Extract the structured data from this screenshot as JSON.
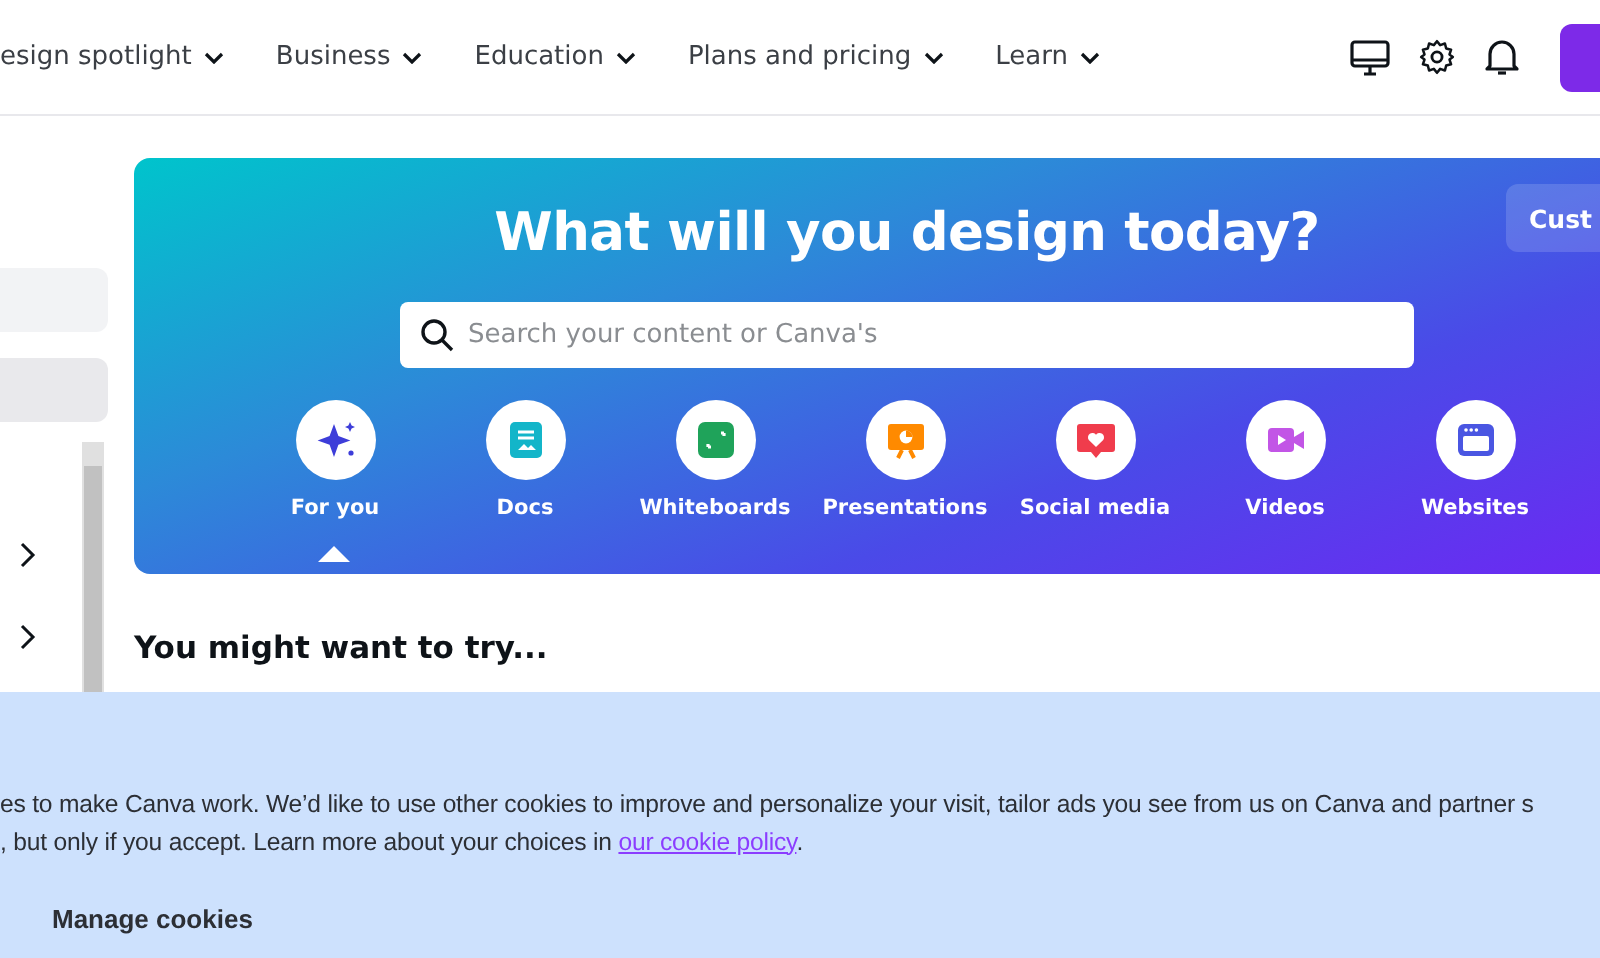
{
  "nav": {
    "items": [
      {
        "label": "esign spotlight"
      },
      {
        "label": "Business"
      },
      {
        "label": "Education"
      },
      {
        "label": "Plans and pricing"
      },
      {
        "label": "Learn"
      }
    ]
  },
  "hero": {
    "title": "What will you design today?",
    "side_button": "Cust",
    "search": {
      "placeholder": "Search your content or Canva's"
    },
    "categories": [
      {
        "label": "For you",
        "kind": "sparkle",
        "selected": true
      },
      {
        "label": "Docs",
        "kind": "doc",
        "selected": false
      },
      {
        "label": "Whiteboards",
        "kind": "board",
        "selected": false
      },
      {
        "label": "Presentations",
        "kind": "present",
        "selected": false
      },
      {
        "label": "Social media",
        "kind": "heart",
        "selected": false
      },
      {
        "label": "Videos",
        "kind": "video",
        "selected": false
      },
      {
        "label": "Websites",
        "kind": "web",
        "selected": false
      }
    ]
  },
  "section_title": "You might want to try...",
  "cookie_banner": {
    "line_1": "es to make Canva work. We’d like to use other cookies to improve and personalize your visit, tailor ads you see from us on Canva and partner s",
    "line_2": ", but only if you accept. Learn more about your choices in ",
    "link": "our cookie policy",
    "line_2_end": ".",
    "button": "Manage cookies"
  }
}
